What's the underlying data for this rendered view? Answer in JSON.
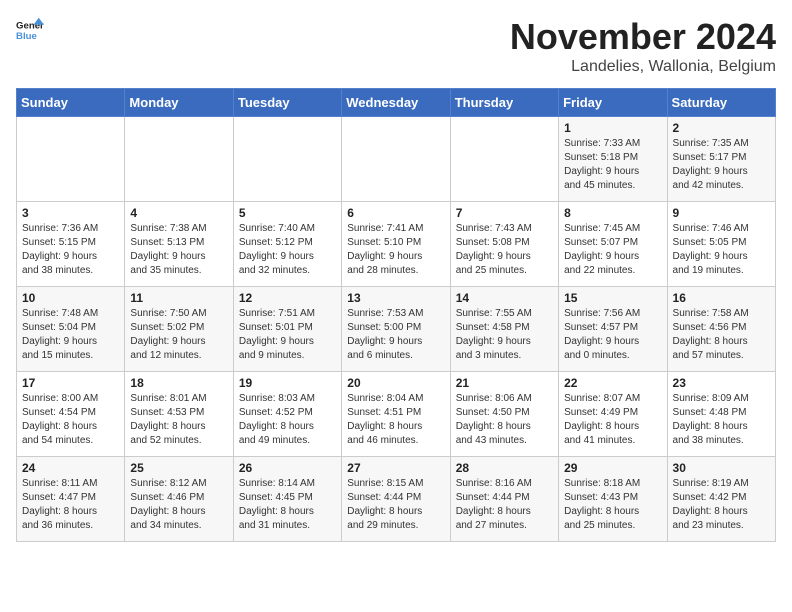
{
  "header": {
    "logo_line1": "General",
    "logo_line2": "Blue",
    "month_title": "November 2024",
    "location": "Landelies, Wallonia, Belgium"
  },
  "weekdays": [
    "Sunday",
    "Monday",
    "Tuesday",
    "Wednesday",
    "Thursday",
    "Friday",
    "Saturday"
  ],
  "weeks": [
    [
      {
        "day": "",
        "info": ""
      },
      {
        "day": "",
        "info": ""
      },
      {
        "day": "",
        "info": ""
      },
      {
        "day": "",
        "info": ""
      },
      {
        "day": "",
        "info": ""
      },
      {
        "day": "1",
        "info": "Sunrise: 7:33 AM\nSunset: 5:18 PM\nDaylight: 9 hours\nand 45 minutes."
      },
      {
        "day": "2",
        "info": "Sunrise: 7:35 AM\nSunset: 5:17 PM\nDaylight: 9 hours\nand 42 minutes."
      }
    ],
    [
      {
        "day": "3",
        "info": "Sunrise: 7:36 AM\nSunset: 5:15 PM\nDaylight: 9 hours\nand 38 minutes."
      },
      {
        "day": "4",
        "info": "Sunrise: 7:38 AM\nSunset: 5:13 PM\nDaylight: 9 hours\nand 35 minutes."
      },
      {
        "day": "5",
        "info": "Sunrise: 7:40 AM\nSunset: 5:12 PM\nDaylight: 9 hours\nand 32 minutes."
      },
      {
        "day": "6",
        "info": "Sunrise: 7:41 AM\nSunset: 5:10 PM\nDaylight: 9 hours\nand 28 minutes."
      },
      {
        "day": "7",
        "info": "Sunrise: 7:43 AM\nSunset: 5:08 PM\nDaylight: 9 hours\nand 25 minutes."
      },
      {
        "day": "8",
        "info": "Sunrise: 7:45 AM\nSunset: 5:07 PM\nDaylight: 9 hours\nand 22 minutes."
      },
      {
        "day": "9",
        "info": "Sunrise: 7:46 AM\nSunset: 5:05 PM\nDaylight: 9 hours\nand 19 minutes."
      }
    ],
    [
      {
        "day": "10",
        "info": "Sunrise: 7:48 AM\nSunset: 5:04 PM\nDaylight: 9 hours\nand 15 minutes."
      },
      {
        "day": "11",
        "info": "Sunrise: 7:50 AM\nSunset: 5:02 PM\nDaylight: 9 hours\nand 12 minutes."
      },
      {
        "day": "12",
        "info": "Sunrise: 7:51 AM\nSunset: 5:01 PM\nDaylight: 9 hours\nand 9 minutes."
      },
      {
        "day": "13",
        "info": "Sunrise: 7:53 AM\nSunset: 5:00 PM\nDaylight: 9 hours\nand 6 minutes."
      },
      {
        "day": "14",
        "info": "Sunrise: 7:55 AM\nSunset: 4:58 PM\nDaylight: 9 hours\nand 3 minutes."
      },
      {
        "day": "15",
        "info": "Sunrise: 7:56 AM\nSunset: 4:57 PM\nDaylight: 9 hours\nand 0 minutes."
      },
      {
        "day": "16",
        "info": "Sunrise: 7:58 AM\nSunset: 4:56 PM\nDaylight: 8 hours\nand 57 minutes."
      }
    ],
    [
      {
        "day": "17",
        "info": "Sunrise: 8:00 AM\nSunset: 4:54 PM\nDaylight: 8 hours\nand 54 minutes."
      },
      {
        "day": "18",
        "info": "Sunrise: 8:01 AM\nSunset: 4:53 PM\nDaylight: 8 hours\nand 52 minutes."
      },
      {
        "day": "19",
        "info": "Sunrise: 8:03 AM\nSunset: 4:52 PM\nDaylight: 8 hours\nand 49 minutes."
      },
      {
        "day": "20",
        "info": "Sunrise: 8:04 AM\nSunset: 4:51 PM\nDaylight: 8 hours\nand 46 minutes."
      },
      {
        "day": "21",
        "info": "Sunrise: 8:06 AM\nSunset: 4:50 PM\nDaylight: 8 hours\nand 43 minutes."
      },
      {
        "day": "22",
        "info": "Sunrise: 8:07 AM\nSunset: 4:49 PM\nDaylight: 8 hours\nand 41 minutes."
      },
      {
        "day": "23",
        "info": "Sunrise: 8:09 AM\nSunset: 4:48 PM\nDaylight: 8 hours\nand 38 minutes."
      }
    ],
    [
      {
        "day": "24",
        "info": "Sunrise: 8:11 AM\nSunset: 4:47 PM\nDaylight: 8 hours\nand 36 minutes."
      },
      {
        "day": "25",
        "info": "Sunrise: 8:12 AM\nSunset: 4:46 PM\nDaylight: 8 hours\nand 34 minutes."
      },
      {
        "day": "26",
        "info": "Sunrise: 8:14 AM\nSunset: 4:45 PM\nDaylight: 8 hours\nand 31 minutes."
      },
      {
        "day": "27",
        "info": "Sunrise: 8:15 AM\nSunset: 4:44 PM\nDaylight: 8 hours\nand 29 minutes."
      },
      {
        "day": "28",
        "info": "Sunrise: 8:16 AM\nSunset: 4:44 PM\nDaylight: 8 hours\nand 27 minutes."
      },
      {
        "day": "29",
        "info": "Sunrise: 8:18 AM\nSunset: 4:43 PM\nDaylight: 8 hours\nand 25 minutes."
      },
      {
        "day": "30",
        "info": "Sunrise: 8:19 AM\nSunset: 4:42 PM\nDaylight: 8 hours\nand 23 minutes."
      }
    ]
  ]
}
